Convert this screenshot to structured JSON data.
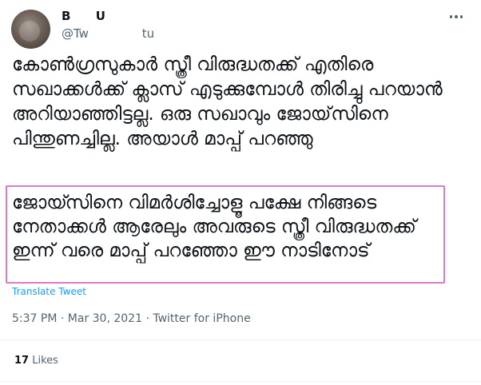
{
  "user": {
    "name": "B      U",
    "handle": "@Tw              tu"
  },
  "tweet": {
    "text": "കോൺഗ്രസുകാർ സ്ത്രീ വിരുദ്ധതക്ക് എതിരെ സഖാക്കൾക്ക് ക്ലാസ് എടുക്കുമ്പോൾ തിരിച്ചു പറയാൻ അറിയാഞ്ഞിട്ടല്ല. ഒരു സഖാവും ജോയ്‌സിനെ പിന്തുണച്ചില്ല. അയാൾ മാപ്പ് പറഞ്ഞു",
    "highlighted_text": "ജോയ്സിനെ വിമർശിച്ചോളൂ പക്ഷേ നിങ്ങടെ നേതാക്കൾ ആരേലും അവരുടെ സ്ത്രീ വിരുദ്ധതക്ക് ഇന്ന് വരെ മാപ്പ് പറഞ്ഞോ ഈ നാടിനോട്",
    "translate_label": "Translate Tweet",
    "time": "5:37 PM",
    "separator": " · ",
    "date": "Mar 30, 2021",
    "source": "Twitter for iPhone"
  },
  "stats": {
    "likes_count": "17",
    "likes_label": "Likes"
  },
  "colors": {
    "highlight_border": "#d97bc9",
    "link": "#1d9bf0",
    "secondary_text": "#536471"
  }
}
